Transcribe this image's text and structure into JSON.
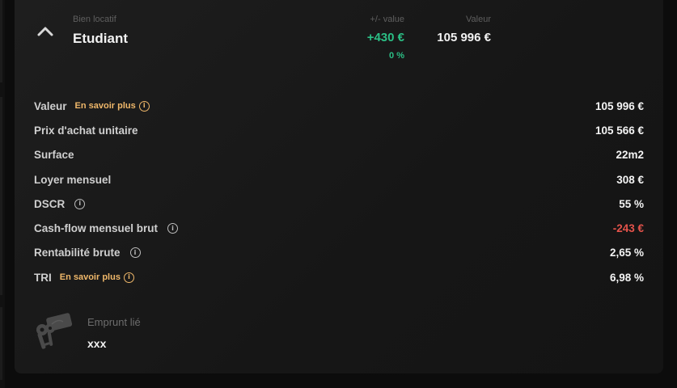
{
  "header": {
    "asset_type": "Bien locatif",
    "asset_name": "Etudiant",
    "plus_minus_label": "+/- value",
    "plus_minus_value": "+430 €",
    "plus_minus_pct": "0 %",
    "value_label": "Valeur",
    "value_amount": "105 996 €"
  },
  "details": {
    "learn_more_label": "En savoir plus",
    "rows": [
      {
        "label": "Valeur",
        "value": "105 996 €"
      },
      {
        "label": "Prix d'achat unitaire",
        "value": "105 566 €"
      },
      {
        "label": "Surface",
        "value": "22m2"
      },
      {
        "label": "Loyer mensuel",
        "value": "308 €"
      },
      {
        "label": "DSCR",
        "value": "55 %"
      },
      {
        "label": "Cash-flow mensuel brut",
        "value": "-243 €"
      },
      {
        "label": "Rentabilité brute",
        "value": "2,65 %"
      },
      {
        "label": "TRI",
        "value": "6,98 %"
      }
    ]
  },
  "loan": {
    "label": "Emprunt lié",
    "name": "xxx"
  },
  "colors": {
    "positive": "#2bbf85",
    "negative": "#e5534b",
    "accent": "#f0b86a",
    "card_bg": "#1a1a1a",
    "page_bg": "#0c0c0c"
  },
  "icons": {
    "collapse": "chevron-up-icon",
    "info": "info-icon",
    "loan": "keys-icon"
  }
}
